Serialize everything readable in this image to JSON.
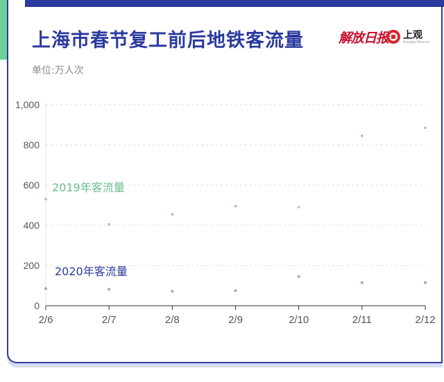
{
  "header": {
    "title": "上海市春节复工前后地铁客流量",
    "unit": "单位:万人次",
    "logo_jiefang": "解放日报",
    "logo_shangguan": "上观",
    "logo_shangguan_sub": "Shanghai Observer"
  },
  "colors": {
    "primary": "#2b3a9e",
    "accent": "#6ccf97",
    "series_2019": "#6cbf8f",
    "series_2020": "#2b3a9e",
    "grid": "#d9d9d9",
    "axis_text": "#555555"
  },
  "chart_data": {
    "type": "scatter",
    "categories": [
      "2/6",
      "2/7",
      "2/8",
      "2/9",
      "2/10",
      "2/11",
      "2/12"
    ],
    "series": [
      {
        "name": "2019年客流量",
        "values": [
          530,
          405,
          455,
          495,
          490,
          845,
          885
        ]
      },
      {
        "name": "2020年客流量",
        "values": [
          85,
          82,
          72,
          75,
          145,
          115,
          115
        ]
      }
    ],
    "ylim": [
      0,
      1000
    ],
    "yticks": [
      0,
      200,
      400,
      600,
      800,
      1000
    ],
    "yticklabels": [
      "0",
      "200",
      "400",
      "600",
      "800",
      "1,000"
    ],
    "grid": true,
    "xlabel": "",
    "ylabel": ""
  }
}
